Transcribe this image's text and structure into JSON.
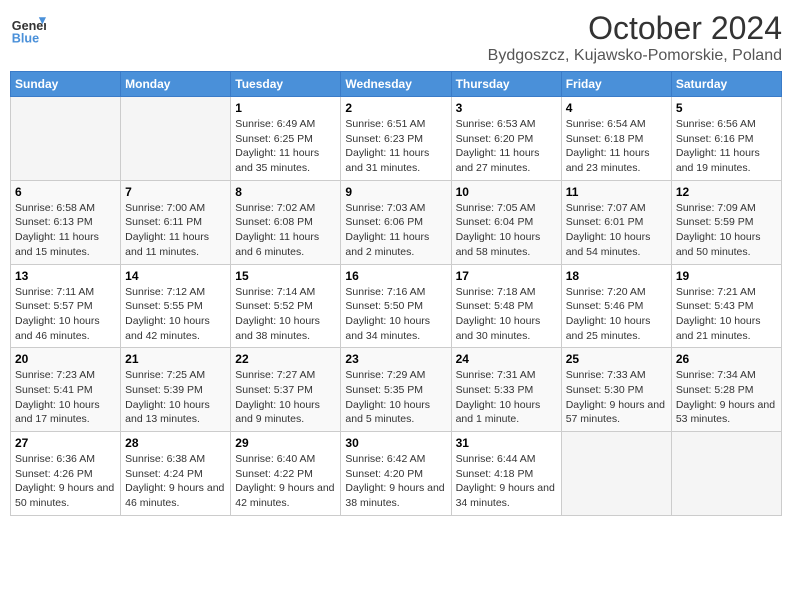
{
  "header": {
    "logo_line1": "General",
    "logo_line2": "Blue",
    "month": "October 2024",
    "location": "Bydgoszcz, Kujawsko-Pomorskie, Poland"
  },
  "days_of_week": [
    "Sunday",
    "Monday",
    "Tuesday",
    "Wednesday",
    "Thursday",
    "Friday",
    "Saturday"
  ],
  "weeks": [
    [
      {
        "day": null
      },
      {
        "day": null
      },
      {
        "day": "1",
        "sunrise": "6:49 AM",
        "sunset": "6:25 PM",
        "daylight": "11 hours and 35 minutes."
      },
      {
        "day": "2",
        "sunrise": "6:51 AM",
        "sunset": "6:23 PM",
        "daylight": "11 hours and 31 minutes."
      },
      {
        "day": "3",
        "sunrise": "6:53 AM",
        "sunset": "6:20 PM",
        "daylight": "11 hours and 27 minutes."
      },
      {
        "day": "4",
        "sunrise": "6:54 AM",
        "sunset": "6:18 PM",
        "daylight": "11 hours and 23 minutes."
      },
      {
        "day": "5",
        "sunrise": "6:56 AM",
        "sunset": "6:16 PM",
        "daylight": "11 hours and 19 minutes."
      }
    ],
    [
      {
        "day": "6",
        "sunrise": "6:58 AM",
        "sunset": "6:13 PM",
        "daylight": "11 hours and 15 minutes."
      },
      {
        "day": "7",
        "sunrise": "7:00 AM",
        "sunset": "6:11 PM",
        "daylight": "11 hours and 11 minutes."
      },
      {
        "day": "8",
        "sunrise": "7:02 AM",
        "sunset": "6:08 PM",
        "daylight": "11 hours and 6 minutes."
      },
      {
        "day": "9",
        "sunrise": "7:03 AM",
        "sunset": "6:06 PM",
        "daylight": "11 hours and 2 minutes."
      },
      {
        "day": "10",
        "sunrise": "7:05 AM",
        "sunset": "6:04 PM",
        "daylight": "10 hours and 58 minutes."
      },
      {
        "day": "11",
        "sunrise": "7:07 AM",
        "sunset": "6:01 PM",
        "daylight": "10 hours and 54 minutes."
      },
      {
        "day": "12",
        "sunrise": "7:09 AM",
        "sunset": "5:59 PM",
        "daylight": "10 hours and 50 minutes."
      }
    ],
    [
      {
        "day": "13",
        "sunrise": "7:11 AM",
        "sunset": "5:57 PM",
        "daylight": "10 hours and 46 minutes."
      },
      {
        "day": "14",
        "sunrise": "7:12 AM",
        "sunset": "5:55 PM",
        "daylight": "10 hours and 42 minutes."
      },
      {
        "day": "15",
        "sunrise": "7:14 AM",
        "sunset": "5:52 PM",
        "daylight": "10 hours and 38 minutes."
      },
      {
        "day": "16",
        "sunrise": "7:16 AM",
        "sunset": "5:50 PM",
        "daylight": "10 hours and 34 minutes."
      },
      {
        "day": "17",
        "sunrise": "7:18 AM",
        "sunset": "5:48 PM",
        "daylight": "10 hours and 30 minutes."
      },
      {
        "day": "18",
        "sunrise": "7:20 AM",
        "sunset": "5:46 PM",
        "daylight": "10 hours and 25 minutes."
      },
      {
        "day": "19",
        "sunrise": "7:21 AM",
        "sunset": "5:43 PM",
        "daylight": "10 hours and 21 minutes."
      }
    ],
    [
      {
        "day": "20",
        "sunrise": "7:23 AM",
        "sunset": "5:41 PM",
        "daylight": "10 hours and 17 minutes."
      },
      {
        "day": "21",
        "sunrise": "7:25 AM",
        "sunset": "5:39 PM",
        "daylight": "10 hours and 13 minutes."
      },
      {
        "day": "22",
        "sunrise": "7:27 AM",
        "sunset": "5:37 PM",
        "daylight": "10 hours and 9 minutes."
      },
      {
        "day": "23",
        "sunrise": "7:29 AM",
        "sunset": "5:35 PM",
        "daylight": "10 hours and 5 minutes."
      },
      {
        "day": "24",
        "sunrise": "7:31 AM",
        "sunset": "5:33 PM",
        "daylight": "10 hours and 1 minute."
      },
      {
        "day": "25",
        "sunrise": "7:33 AM",
        "sunset": "5:30 PM",
        "daylight": "9 hours and 57 minutes."
      },
      {
        "day": "26",
        "sunrise": "7:34 AM",
        "sunset": "5:28 PM",
        "daylight": "9 hours and 53 minutes."
      }
    ],
    [
      {
        "day": "27",
        "sunrise": "6:36 AM",
        "sunset": "4:26 PM",
        "daylight": "9 hours and 50 minutes."
      },
      {
        "day": "28",
        "sunrise": "6:38 AM",
        "sunset": "4:24 PM",
        "daylight": "9 hours and 46 minutes."
      },
      {
        "day": "29",
        "sunrise": "6:40 AM",
        "sunset": "4:22 PM",
        "daylight": "9 hours and 42 minutes."
      },
      {
        "day": "30",
        "sunrise": "6:42 AM",
        "sunset": "4:20 PM",
        "daylight": "9 hours and 38 minutes."
      },
      {
        "day": "31",
        "sunrise": "6:44 AM",
        "sunset": "4:18 PM",
        "daylight": "9 hours and 34 minutes."
      },
      {
        "day": null
      },
      {
        "day": null
      }
    ]
  ]
}
